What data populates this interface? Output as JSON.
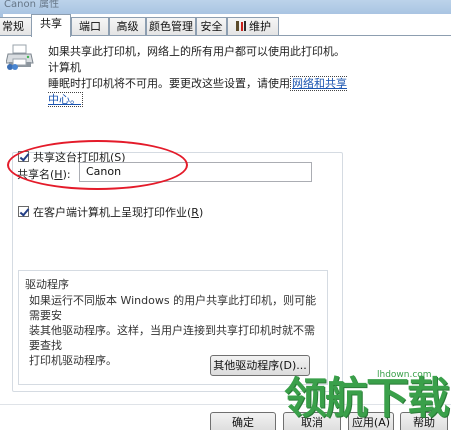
{
  "window": {
    "title": "Canon 属性"
  },
  "tabs": [
    {
      "label": "常规",
      "active": false
    },
    {
      "label": "共享",
      "active": true
    },
    {
      "label": "端口",
      "active": false
    },
    {
      "label": "高级",
      "active": false
    },
    {
      "label": "颜色管理",
      "active": false
    },
    {
      "label": "安全",
      "active": false
    },
    {
      "label": "维护",
      "active": false,
      "icon": "tools-icon"
    }
  ],
  "intro": {
    "line1": "如果共享此打印机，网络上的所有用户都可以使用此打印机。计算机",
    "line2_prefix": "睡眠时打印机将不可用。要更改这些设置，请使用",
    "link": "网络和共享中心。"
  },
  "share_printer": {
    "checked": true,
    "label": "共享这台打印机(",
    "hotkey": "S",
    "suffix": ")"
  },
  "share_name": {
    "label": "共享名(",
    "hotkey": "H",
    "suffix": "):",
    "value": "Canon"
  },
  "render_on_client": {
    "checked": true,
    "label": "在客户端计算机上呈现打印作业(",
    "hotkey": "R",
    "suffix": ")"
  },
  "drivers": {
    "legend": "驱动程序",
    "desc_line1": "如果运行不同版本 Windows 的用户共享此打印机，则可能需要安",
    "desc_line2": "装其他驱动程序。这样，当用户连接到共享打印机时就不需要查找",
    "desc_line3": "打印机驱动程序。",
    "button": "其他驱动程序(D)..."
  },
  "dialog_buttons": {
    "ok": "确定",
    "cancel": "取消",
    "apply": "应用(A)",
    "help": "帮助"
  },
  "watermark": {
    "text": "领航下载",
    "site": "lhdown.com",
    "color": "#3aa04a"
  },
  "colors": {
    "highlight": "#e41b2a",
    "link": "#1a54b0"
  }
}
